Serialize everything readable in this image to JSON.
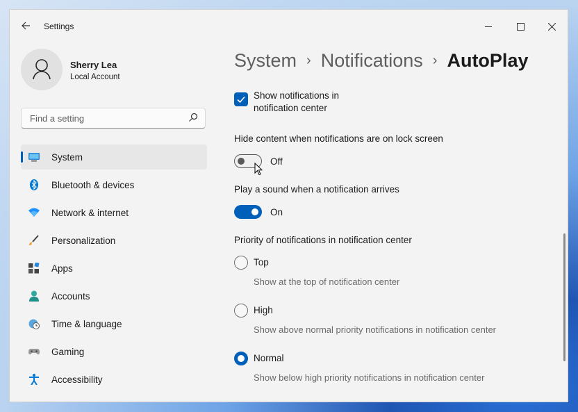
{
  "window": {
    "title": "Settings"
  },
  "user": {
    "name": "Sherry Lea",
    "account_type": "Local Account"
  },
  "search": {
    "placeholder": "Find a setting"
  },
  "sidebar": {
    "items": [
      {
        "label": "System",
        "icon": "system-icon",
        "selected": true
      },
      {
        "label": "Bluetooth & devices",
        "icon": "bluetooth-icon"
      },
      {
        "label": "Network & internet",
        "icon": "wifi-icon"
      },
      {
        "label": "Personalization",
        "icon": "brush-icon"
      },
      {
        "label": "Apps",
        "icon": "apps-icon"
      },
      {
        "label": "Accounts",
        "icon": "person-icon"
      },
      {
        "label": "Time & language",
        "icon": "clock-globe-icon"
      },
      {
        "label": "Gaming",
        "icon": "gamepad-icon"
      },
      {
        "label": "Accessibility",
        "icon": "accessibility-icon"
      }
    ]
  },
  "breadcrumb": {
    "level1": "System",
    "level2": "Notifications",
    "current": "AutoPlay",
    "separator": "›"
  },
  "content": {
    "show_in_center": {
      "label": "Show notifications in notification center",
      "checked": true
    },
    "hide_content": {
      "label": "Hide content when notifications are on lock screen",
      "state": "Off"
    },
    "play_sound": {
      "label": "Play a sound when a notification arrives",
      "state": "On"
    },
    "priority": {
      "label": "Priority of notifications in notification center",
      "options": [
        {
          "label": "Top",
          "desc": "Show at the top of notification center",
          "selected": false
        },
        {
          "label": "High",
          "desc": "Show above normal priority notifications in notification center",
          "selected": false
        },
        {
          "label": "Normal",
          "desc": "Show below high priority notifications in notification center",
          "selected": true
        }
      ]
    }
  },
  "colors": {
    "accent": "#005fb8",
    "window_bg": "#f3f3f3"
  }
}
